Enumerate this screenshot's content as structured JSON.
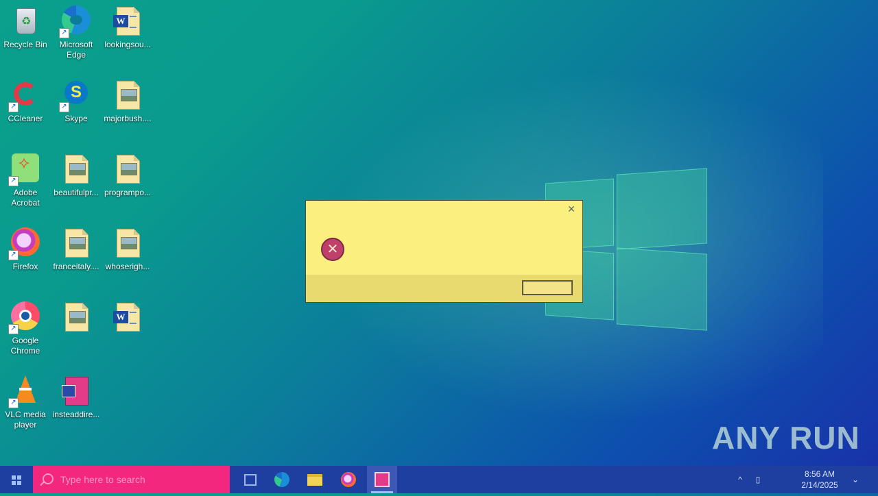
{
  "desktop": {
    "icons": [
      {
        "label": "Recycle Bin",
        "icon": "recycle-bin-icon"
      },
      {
        "label": "Microsoft Edge",
        "icon": "edge-icon"
      },
      {
        "label": "lookingsou...",
        "icon": "word-document-icon"
      },
      {
        "label": "CCleaner",
        "icon": "ccleaner-icon"
      },
      {
        "label": "Skype",
        "icon": "skype-icon"
      },
      {
        "label": "majorbush....",
        "icon": "image-file-icon"
      },
      {
        "label": "Adobe Acrobat",
        "icon": "acrobat-icon"
      },
      {
        "label": "beautifulpr...",
        "icon": "image-file-icon"
      },
      {
        "label": "programpo...",
        "icon": "image-file-icon"
      },
      {
        "label": "Firefox",
        "icon": "firefox-icon"
      },
      {
        "label": "franceitaly....",
        "icon": "image-file-icon"
      },
      {
        "label": "whoserigh...",
        "icon": "image-file-icon"
      },
      {
        "label": "Google Chrome",
        "icon": "chrome-icon"
      },
      {
        "label": "",
        "icon": "image-file-icon"
      },
      {
        "label": "",
        "icon": "word-document-icon"
      },
      {
        "label": "VLC media player",
        "icon": "vlc-icon"
      },
      {
        "label": "insteaddire...",
        "icon": "exe-file-icon"
      }
    ]
  },
  "dialog": {
    "close_glyph": "✕",
    "error_glyph": "✕",
    "message": "",
    "ok_label": ""
  },
  "taskbar": {
    "search_placeholder": "Type here to search",
    "time": "8:56 AM",
    "date": "2/14/2025"
  },
  "watermark": "ANY RUN",
  "colors": {
    "search_bg": "#f2277d",
    "taskbar_bg": "#1e3ea0",
    "dialog_bg": "#fbef7e"
  }
}
